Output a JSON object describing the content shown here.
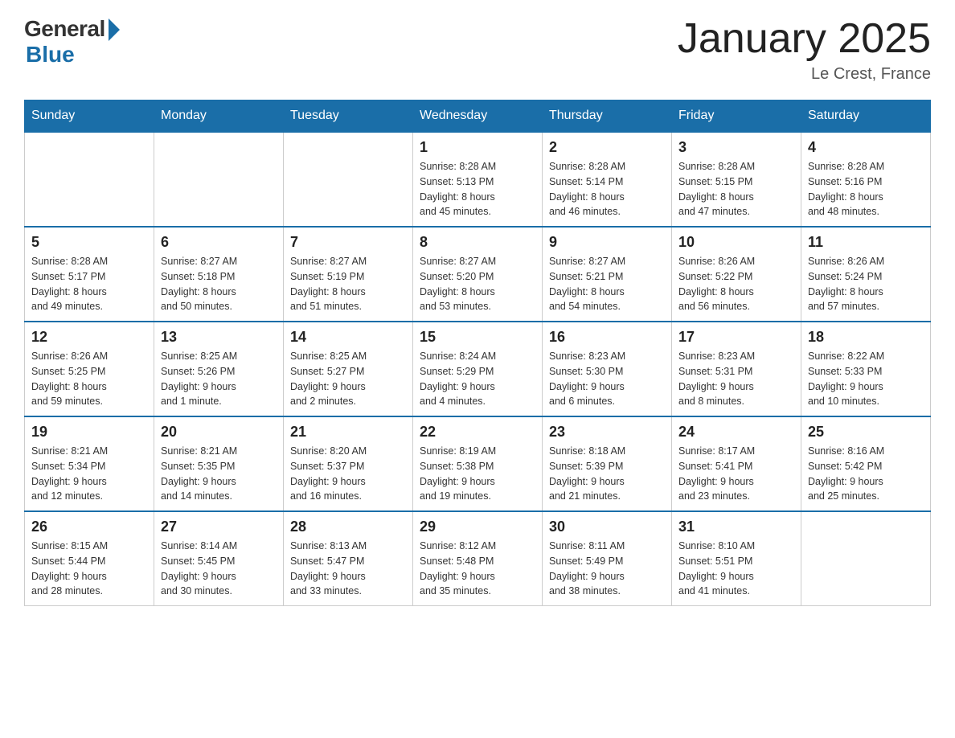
{
  "header": {
    "logo": {
      "general": "General",
      "blue": "Blue"
    },
    "title": "January 2025",
    "location": "Le Crest, France"
  },
  "calendar": {
    "days_of_week": [
      "Sunday",
      "Monday",
      "Tuesday",
      "Wednesday",
      "Thursday",
      "Friday",
      "Saturday"
    ],
    "weeks": [
      [
        {
          "day": "",
          "info": ""
        },
        {
          "day": "",
          "info": ""
        },
        {
          "day": "",
          "info": ""
        },
        {
          "day": "1",
          "info": "Sunrise: 8:28 AM\nSunset: 5:13 PM\nDaylight: 8 hours\nand 45 minutes."
        },
        {
          "day": "2",
          "info": "Sunrise: 8:28 AM\nSunset: 5:14 PM\nDaylight: 8 hours\nand 46 minutes."
        },
        {
          "day": "3",
          "info": "Sunrise: 8:28 AM\nSunset: 5:15 PM\nDaylight: 8 hours\nand 47 minutes."
        },
        {
          "day": "4",
          "info": "Sunrise: 8:28 AM\nSunset: 5:16 PM\nDaylight: 8 hours\nand 48 minutes."
        }
      ],
      [
        {
          "day": "5",
          "info": "Sunrise: 8:28 AM\nSunset: 5:17 PM\nDaylight: 8 hours\nand 49 minutes."
        },
        {
          "day": "6",
          "info": "Sunrise: 8:27 AM\nSunset: 5:18 PM\nDaylight: 8 hours\nand 50 minutes."
        },
        {
          "day": "7",
          "info": "Sunrise: 8:27 AM\nSunset: 5:19 PM\nDaylight: 8 hours\nand 51 minutes."
        },
        {
          "day": "8",
          "info": "Sunrise: 8:27 AM\nSunset: 5:20 PM\nDaylight: 8 hours\nand 53 minutes."
        },
        {
          "day": "9",
          "info": "Sunrise: 8:27 AM\nSunset: 5:21 PM\nDaylight: 8 hours\nand 54 minutes."
        },
        {
          "day": "10",
          "info": "Sunrise: 8:26 AM\nSunset: 5:22 PM\nDaylight: 8 hours\nand 56 minutes."
        },
        {
          "day": "11",
          "info": "Sunrise: 8:26 AM\nSunset: 5:24 PM\nDaylight: 8 hours\nand 57 minutes."
        }
      ],
      [
        {
          "day": "12",
          "info": "Sunrise: 8:26 AM\nSunset: 5:25 PM\nDaylight: 8 hours\nand 59 minutes."
        },
        {
          "day": "13",
          "info": "Sunrise: 8:25 AM\nSunset: 5:26 PM\nDaylight: 9 hours\nand 1 minute."
        },
        {
          "day": "14",
          "info": "Sunrise: 8:25 AM\nSunset: 5:27 PM\nDaylight: 9 hours\nand 2 minutes."
        },
        {
          "day": "15",
          "info": "Sunrise: 8:24 AM\nSunset: 5:29 PM\nDaylight: 9 hours\nand 4 minutes."
        },
        {
          "day": "16",
          "info": "Sunrise: 8:23 AM\nSunset: 5:30 PM\nDaylight: 9 hours\nand 6 minutes."
        },
        {
          "day": "17",
          "info": "Sunrise: 8:23 AM\nSunset: 5:31 PM\nDaylight: 9 hours\nand 8 minutes."
        },
        {
          "day": "18",
          "info": "Sunrise: 8:22 AM\nSunset: 5:33 PM\nDaylight: 9 hours\nand 10 minutes."
        }
      ],
      [
        {
          "day": "19",
          "info": "Sunrise: 8:21 AM\nSunset: 5:34 PM\nDaylight: 9 hours\nand 12 minutes."
        },
        {
          "day": "20",
          "info": "Sunrise: 8:21 AM\nSunset: 5:35 PM\nDaylight: 9 hours\nand 14 minutes."
        },
        {
          "day": "21",
          "info": "Sunrise: 8:20 AM\nSunset: 5:37 PM\nDaylight: 9 hours\nand 16 minutes."
        },
        {
          "day": "22",
          "info": "Sunrise: 8:19 AM\nSunset: 5:38 PM\nDaylight: 9 hours\nand 19 minutes."
        },
        {
          "day": "23",
          "info": "Sunrise: 8:18 AM\nSunset: 5:39 PM\nDaylight: 9 hours\nand 21 minutes."
        },
        {
          "day": "24",
          "info": "Sunrise: 8:17 AM\nSunset: 5:41 PM\nDaylight: 9 hours\nand 23 minutes."
        },
        {
          "day": "25",
          "info": "Sunrise: 8:16 AM\nSunset: 5:42 PM\nDaylight: 9 hours\nand 25 minutes."
        }
      ],
      [
        {
          "day": "26",
          "info": "Sunrise: 8:15 AM\nSunset: 5:44 PM\nDaylight: 9 hours\nand 28 minutes."
        },
        {
          "day": "27",
          "info": "Sunrise: 8:14 AM\nSunset: 5:45 PM\nDaylight: 9 hours\nand 30 minutes."
        },
        {
          "day": "28",
          "info": "Sunrise: 8:13 AM\nSunset: 5:47 PM\nDaylight: 9 hours\nand 33 minutes."
        },
        {
          "day": "29",
          "info": "Sunrise: 8:12 AM\nSunset: 5:48 PM\nDaylight: 9 hours\nand 35 minutes."
        },
        {
          "day": "30",
          "info": "Sunrise: 8:11 AM\nSunset: 5:49 PM\nDaylight: 9 hours\nand 38 minutes."
        },
        {
          "day": "31",
          "info": "Sunrise: 8:10 AM\nSunset: 5:51 PM\nDaylight: 9 hours\nand 41 minutes."
        },
        {
          "day": "",
          "info": ""
        }
      ]
    ]
  }
}
